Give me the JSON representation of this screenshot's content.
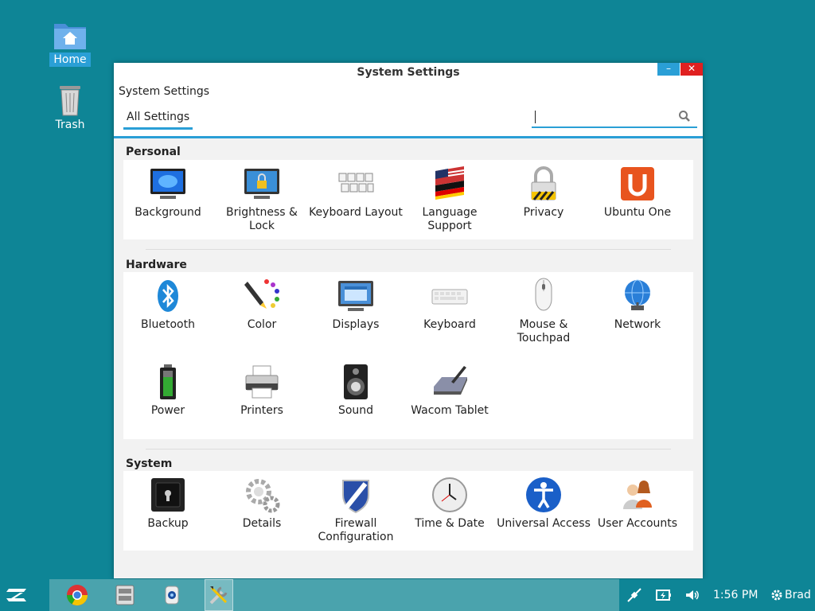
{
  "desktop": {
    "icons": [
      {
        "label": "Home",
        "icon": "home-folder-icon"
      },
      {
        "label": "Trash",
        "icon": "trash-icon"
      }
    ]
  },
  "window": {
    "title": "System Settings",
    "breadcrumb": "System Settings",
    "tab": "All Settings",
    "search": {
      "value": "",
      "placeholder": ""
    },
    "controls": {
      "minimize": "–",
      "close": "✕"
    }
  },
  "sections": [
    {
      "title": "Personal",
      "items": [
        {
          "label": "Background",
          "icon": "monitor-blue-icon"
        },
        {
          "label": "Brightness & Lock",
          "icon": "monitor-lock-icon"
        },
        {
          "label": "Keyboard Layout",
          "icon": "keyboard-keys-icon"
        },
        {
          "label": "Language Support",
          "icon": "flags-icon"
        },
        {
          "label": "Privacy",
          "icon": "padlock-icon"
        },
        {
          "label": "Ubuntu One",
          "icon": "ubuntu-one-icon"
        }
      ]
    },
    {
      "title": "Hardware",
      "items": [
        {
          "label": "Bluetooth",
          "icon": "bluetooth-icon"
        },
        {
          "label": "Color",
          "icon": "color-pen-icon"
        },
        {
          "label": "Displays",
          "icon": "display-icon"
        },
        {
          "label": "Keyboard",
          "icon": "keyboard-icon"
        },
        {
          "label": "Mouse & Touchpad",
          "icon": "mouse-icon"
        },
        {
          "label": "Network",
          "icon": "globe-network-icon"
        },
        {
          "label": "Power",
          "icon": "battery-icon"
        },
        {
          "label": "Printers",
          "icon": "printer-icon"
        },
        {
          "label": "Sound",
          "icon": "speaker-icon"
        },
        {
          "label": "Wacom Tablet",
          "icon": "tablet-pen-icon"
        }
      ]
    },
    {
      "title": "System",
      "items": [
        {
          "label": "Backup",
          "icon": "safe-icon"
        },
        {
          "label": "Details",
          "icon": "gears-icon"
        },
        {
          "label": "Firewall Configuration",
          "icon": "shield-icon"
        },
        {
          "label": "Time & Date",
          "icon": "clock-icon"
        },
        {
          "label": "Universal Access",
          "icon": "accessibility-icon"
        },
        {
          "label": "User Accounts",
          "icon": "users-icon"
        }
      ]
    }
  ],
  "taskbar": {
    "start_icon": "zorin-logo-icon",
    "apps": [
      {
        "icon": "chrome-icon",
        "active": false
      },
      {
        "icon": "file-manager-icon",
        "active": false
      },
      {
        "icon": "webcam-icon",
        "active": false
      },
      {
        "icon": "system-tools-icon",
        "active": true
      }
    ],
    "tray": {
      "clock": "1:56 PM",
      "user": "Brad"
    }
  },
  "colors": {
    "desktop": "#0e8596",
    "accent": "#2a9fd6",
    "close": "#e02020"
  }
}
